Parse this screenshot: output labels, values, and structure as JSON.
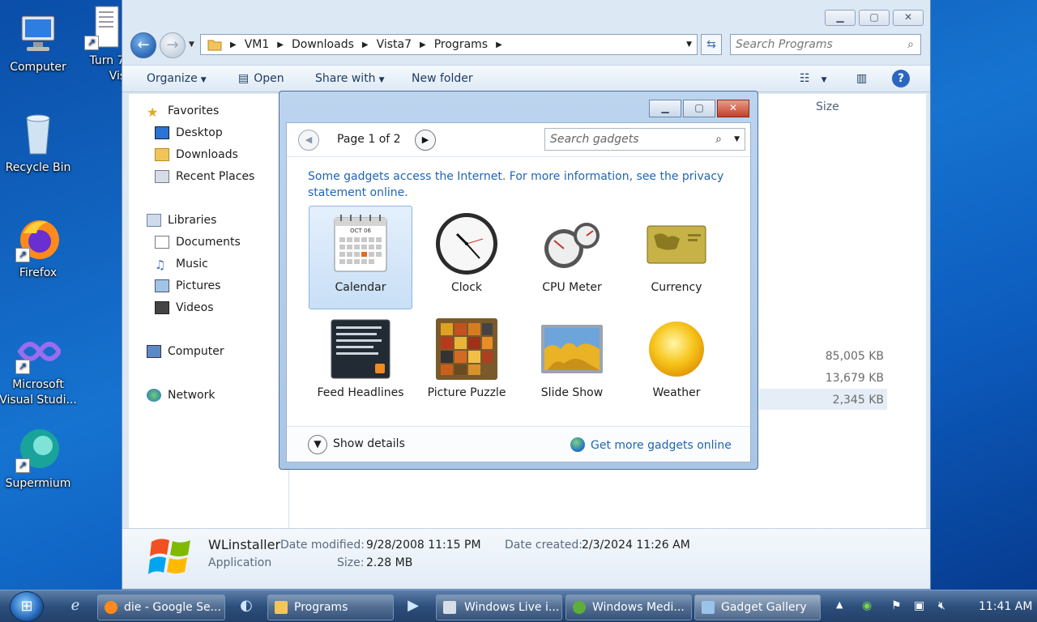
{
  "desktop": {
    "icons": [
      {
        "label": "Computer"
      },
      {
        "label": "Turn 7",
        "label2": "Vista"
      },
      {
        "label": "Recycle Bin"
      },
      {
        "label": "Firefox"
      },
      {
        "label": "Microsoft",
        "label2": "Visual Studi..."
      },
      {
        "label": "Supermium"
      }
    ]
  },
  "explorer": {
    "breadcrumb": [
      "VM1",
      "Downloads",
      "Vista7",
      "Programs"
    ],
    "search_placeholder": "Search Programs",
    "toolbar": {
      "organize": "Organize",
      "open": "Open",
      "share_with": "Share with",
      "new_folder": "New folder"
    },
    "nav": {
      "favorites": "Favorites",
      "favorites_items": [
        "Desktop",
        "Downloads",
        "Recent Places"
      ],
      "libraries": "Libraries",
      "libraries_items": [
        "Documents",
        "Music",
        "Pictures",
        "Videos"
      ],
      "computer": "Computer",
      "network": "Network"
    },
    "columns": {
      "size": "Size"
    },
    "sizes": [
      "85,005 KB",
      "13,679 KB",
      "2,345 KB"
    ],
    "details": {
      "name": "WLinstaller",
      "type": "Application",
      "date_modified_label": "Date modified:",
      "date_modified": "9/28/2008 11:15 PM",
      "date_created_label": "Date created:",
      "date_created": "2/3/2024 11:26 AM",
      "size_label": "Size:",
      "size": "2.28 MB"
    }
  },
  "gallery": {
    "page_label": "Page 1 of 2",
    "search_placeholder": "Search gadgets",
    "notice_line1": "Some gadgets access the Internet.  For more information, see the privacy",
    "notice_line2": "statement online.",
    "gadgets": [
      {
        "name": "Calendar"
      },
      {
        "name": "Clock"
      },
      {
        "name": "CPU Meter"
      },
      {
        "name": "Currency"
      },
      {
        "name": "Feed Headlines"
      },
      {
        "name": "Picture Puzzle"
      },
      {
        "name": "Slide Show"
      },
      {
        "name": "Weather"
      }
    ],
    "calendar_month": "OCT 06",
    "show_details": "Show details",
    "get_more": "Get more gadgets online"
  },
  "taskbar": {
    "buttons": [
      {
        "label": "die - Google Se..."
      },
      {
        "label": "Programs"
      },
      {
        "label": "Windows Live i..."
      },
      {
        "label": "Windows Medi..."
      },
      {
        "label": "Gadget Gallery"
      }
    ],
    "time": "11:41 AM"
  }
}
